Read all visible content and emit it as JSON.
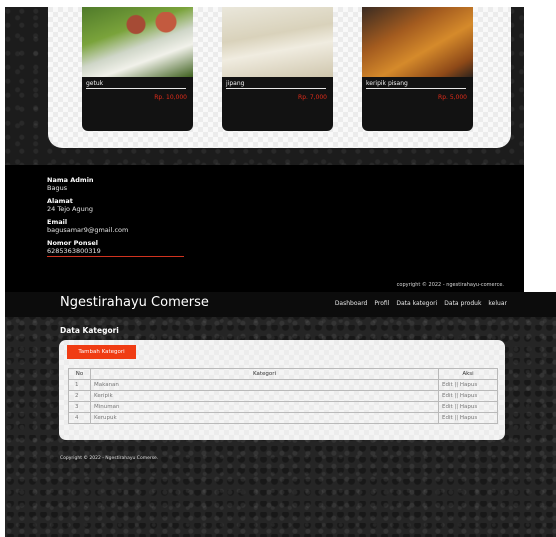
{
  "products": [
    {
      "name": "getuk",
      "price": "Rp. 10,000"
    },
    {
      "name": "jipang",
      "price": "Rp. 7,000"
    },
    {
      "name": "keripik pisang",
      "price": "Rp. 5,000"
    }
  ],
  "admin": {
    "name_label": "Nama Admin",
    "name_value": "Bagus",
    "address_label": "Alamat",
    "address_value": "24 Tejo Agung",
    "email_label": "Email",
    "email_value": "bagusamar9@gmail.com",
    "phone_label": "Nomor Ponsel",
    "phone_value": "6285363800319"
  },
  "footer_top": {
    "copyright": "copyright © 2022 - ngestirahayu-comerce."
  },
  "navbar": {
    "brand": "Ngestirahayu Comerse",
    "links": [
      "Dashboard",
      "Profil",
      "Data kategori",
      "Data produk",
      "keluar"
    ]
  },
  "kategori": {
    "title": "Data Kategori",
    "add_button": "Tambah Kategori",
    "headers": [
      "No",
      "Kategori",
      "Aksi"
    ],
    "rows": [
      {
        "no": "1",
        "name": "Makanan",
        "edit": "Edit",
        "sep": "||",
        "hapus": "Hapus"
      },
      {
        "no": "2",
        "name": "Keripik",
        "edit": "Edit",
        "sep": "||",
        "hapus": "Hapus"
      },
      {
        "no": "3",
        "name": "Minuman",
        "edit": "Edit",
        "sep": "||",
        "hapus": "Hapus"
      },
      {
        "no": "4",
        "name": "Kerupuk",
        "edit": "Edit",
        "sep": "||",
        "hapus": "Hapus"
      }
    ]
  },
  "footer_bottom": {
    "copyright": "Copyright © 2022 - Ngestirahayu Comerse."
  }
}
